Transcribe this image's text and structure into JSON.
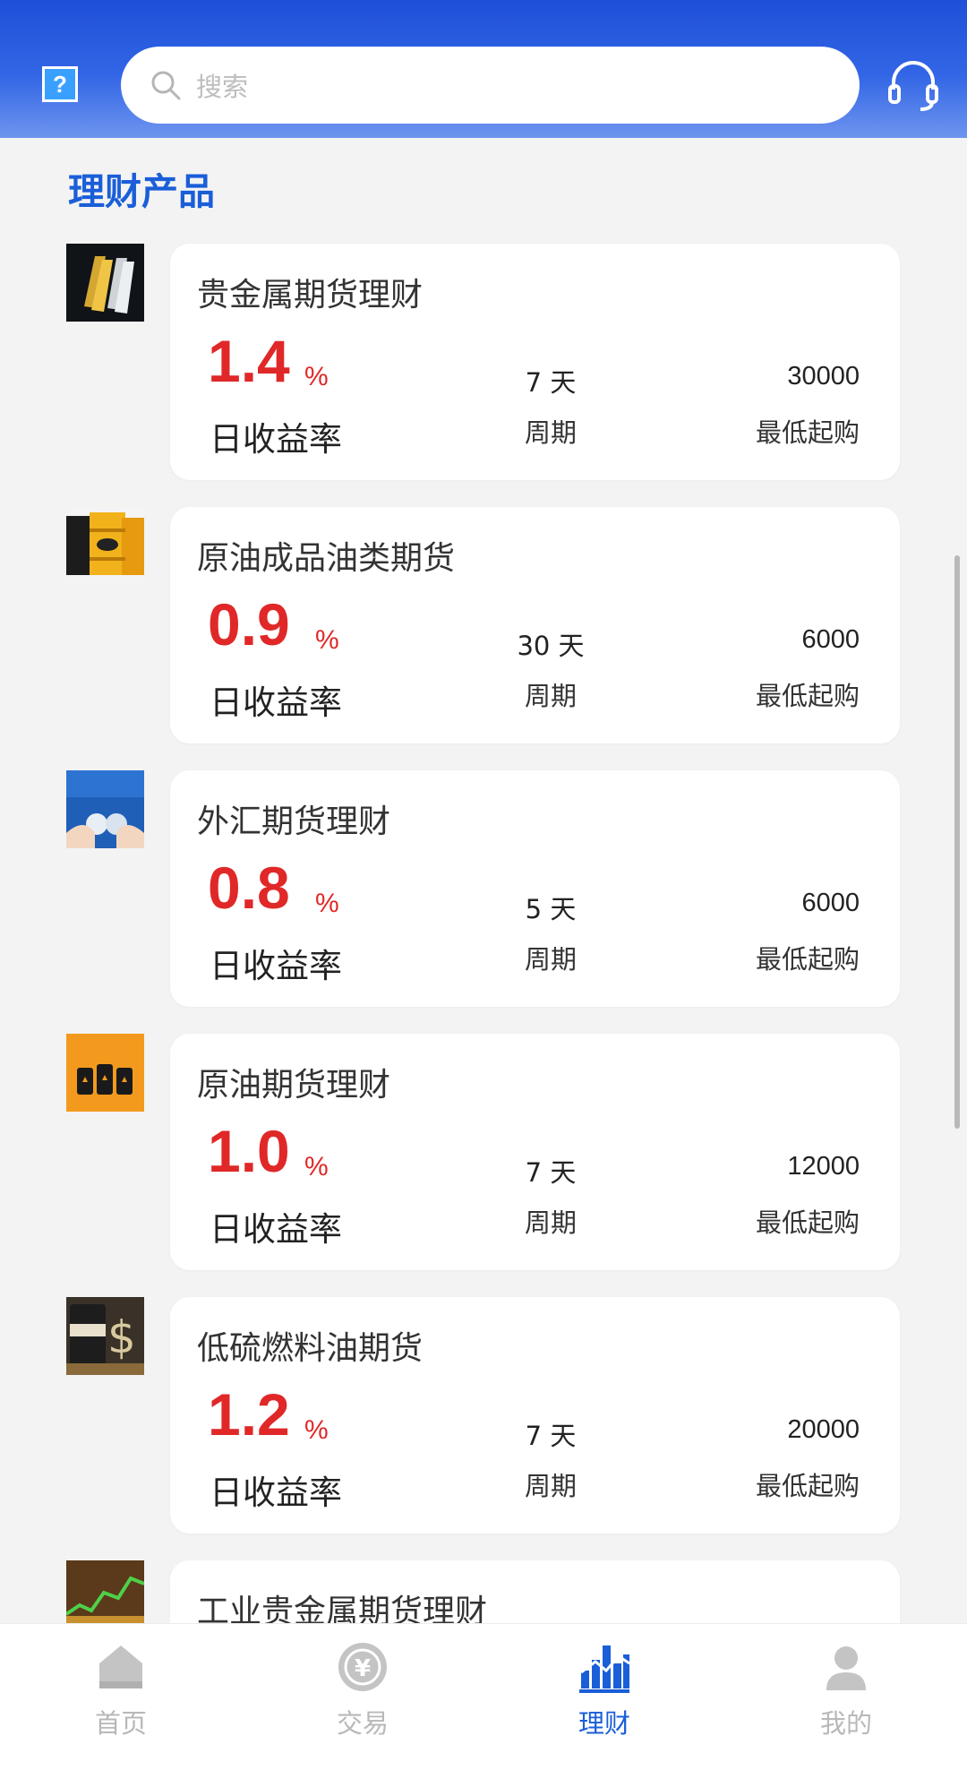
{
  "header": {
    "help_label": "?",
    "search_placeholder": "搜索"
  },
  "section_title": "理财产品",
  "products": [
    {
      "name": "贵金属期货理财",
      "rate": "1.4",
      "rate_unit": "%",
      "rate_label": "日收益率",
      "period": "7 天",
      "period_label": "周期",
      "min_amount": "30000",
      "min_label": "最低起购",
      "thumb": "gold-bars"
    },
    {
      "name": "原油成品油类期货",
      "rate": "0.9",
      "rate_unit": "%",
      "rate_label": "日收益率",
      "period": "30 天",
      "period_label": "周期",
      "min_amount": "6000",
      "min_label": "最低起购",
      "thumb": "oil-barrels"
    },
    {
      "name": "外汇期货理财",
      "rate": "0.8",
      "rate_unit": "%",
      "rate_label": "日收益率",
      "period": "5 天",
      "period_label": "周期",
      "min_amount": "6000",
      "min_label": "最低起购",
      "thumb": "forex-exchange"
    },
    {
      "name": "原油期货理财",
      "rate": "1.0",
      "rate_unit": "%",
      "rate_label": "日收益率",
      "period": "7 天",
      "period_label": "周期",
      "min_amount": "12000",
      "min_label": "最低起购",
      "thumb": "oil-barrels-orange"
    },
    {
      "name": "低硫燃料油期货",
      "rate": "1.2",
      "rate_unit": "%",
      "rate_label": "日收益率",
      "period": "7 天",
      "period_label": "周期",
      "min_amount": "20000",
      "min_label": "最低起购",
      "thumb": "oil-dollar"
    },
    {
      "name": "工业贵金属期货理财",
      "thumb": "metals-chart"
    }
  ],
  "tabbar": [
    {
      "label": "首页",
      "icon": "home-icon",
      "active": false
    },
    {
      "label": "交易",
      "icon": "yuan-coin-icon",
      "active": false
    },
    {
      "label": "理财",
      "icon": "chart-icon",
      "active": true
    },
    {
      "label": "我的",
      "icon": "user-icon",
      "active": false
    }
  ],
  "colors": {
    "header_top": "#1e4fd8",
    "accent": "#1a5ed8",
    "rate_red": "#e02828",
    "inactive_tab": "#b8b8b8"
  }
}
